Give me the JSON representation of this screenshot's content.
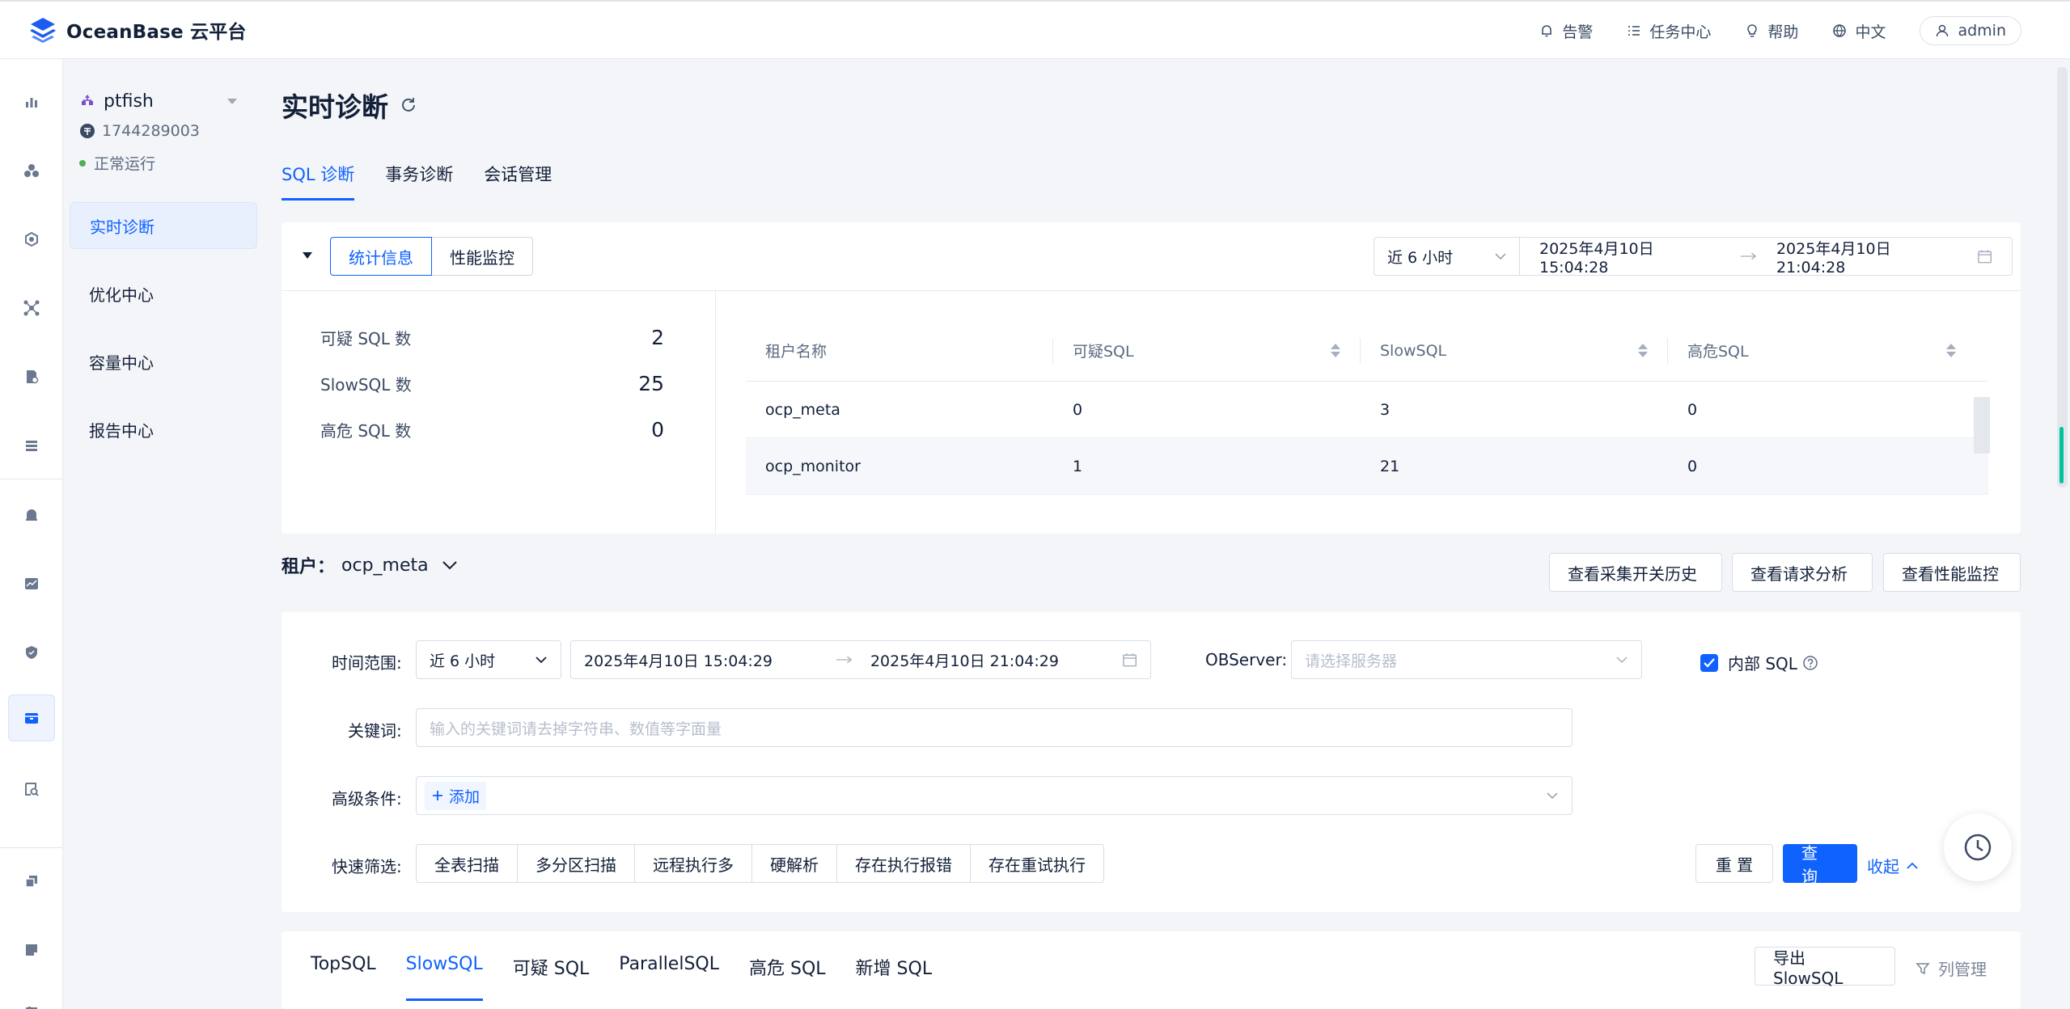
{
  "app": {
    "logo_text": "OceanBase 云平台"
  },
  "topbar": {
    "alert": "告警",
    "tasks": "任务中心",
    "help": "帮助",
    "lang": "中文",
    "user": "admin"
  },
  "tenant": {
    "name": "ptfish",
    "id": "1744289003",
    "status": "正常运行"
  },
  "subnav": [
    "实时诊断",
    "优化中心",
    "容量中心",
    "报告中心"
  ],
  "page": {
    "title": "实时诊断"
  },
  "tabs": [
    "SQL 诊断",
    "事务诊断",
    "会话管理"
  ],
  "overview": {
    "seg_stats": "统计信息",
    "seg_perf": "性能监控",
    "range_preset": "近 6 小时",
    "range_start": "2025年4月10日 15:04:28",
    "range_end": "2025年4月10日 21:04:28",
    "stats": [
      {
        "label": "可疑 SQL 数",
        "value": "2"
      },
      {
        "label": "SlowSQL 数",
        "value": "25"
      },
      {
        "label": "高危 SQL 数",
        "value": "0"
      }
    ],
    "table": {
      "headers": [
        "租户名称",
        "可疑SQL",
        "SlowSQL",
        "高危SQL"
      ],
      "rows": [
        [
          "ocp_meta",
          "0",
          "3",
          "0"
        ],
        [
          "ocp_monitor",
          "1",
          "21",
          "0"
        ]
      ]
    }
  },
  "tenant_select": {
    "label": "租户：",
    "value": "ocp_meta"
  },
  "actions": {
    "history": "查看采集开关历史",
    "request": "查看请求分析",
    "perf": "查看性能监控"
  },
  "filter": {
    "time_label": "时间范围:",
    "time_preset": "近 6 小时",
    "time_start": "2025年4月10日 15:04:29",
    "time_end": "2025年4月10日 21:04:29",
    "observer_label": "OBServer:",
    "observer_placeholder": "请选择服务器",
    "internal_sql": "内部 SQL",
    "keyword_label": "关键词:",
    "keyword_placeholder": "输入的关键词请去掉字符串、数值等字面量",
    "advanced_label": "高级条件:",
    "add": "添加",
    "quick_label": "快速筛选:",
    "quick": [
      "全表扫描",
      "多分区扫描",
      "远程执行多",
      "硬解析",
      "存在执行报错",
      "存在重试执行"
    ],
    "reset": "重 置",
    "query": "查 询",
    "collapse": "收起"
  },
  "bottom_tabs": [
    "TopSQL",
    "SlowSQL",
    "可疑 SQL",
    "ParallelSQL",
    "高危 SQL",
    "新增 SQL"
  ],
  "bottom_actions": {
    "export": "导出 SlowSQL",
    "columns": "列管理"
  },
  "colors": {
    "primary": "#0f62fe",
    "status_ok": "#4caf50"
  }
}
